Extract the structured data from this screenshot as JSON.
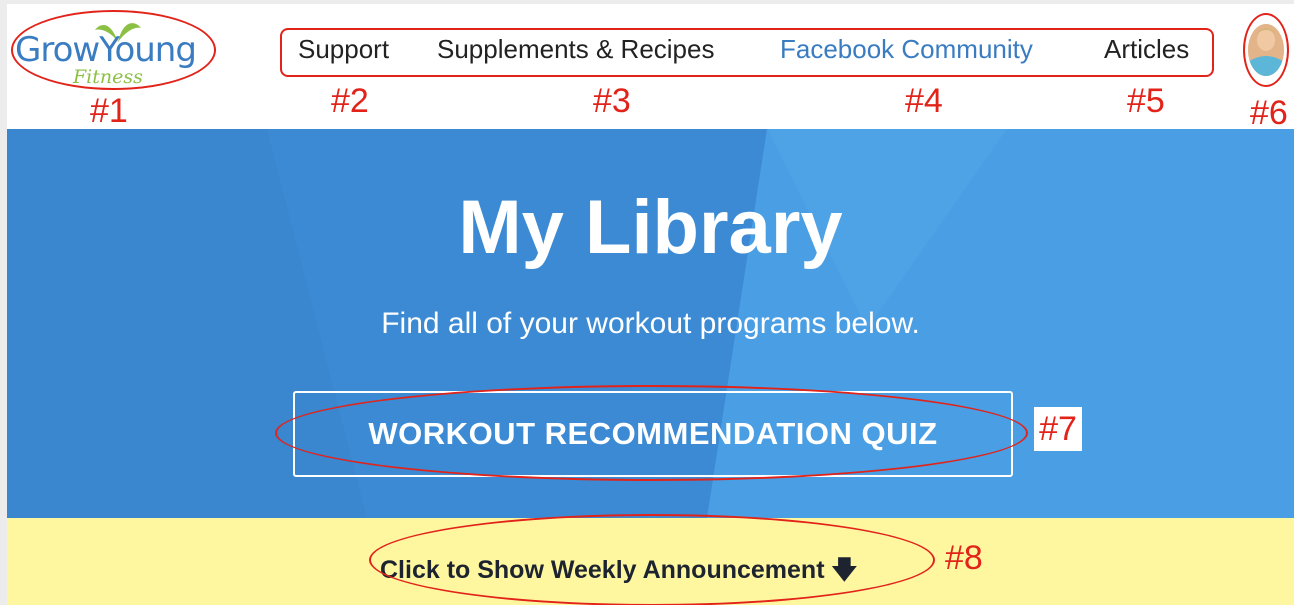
{
  "logo": {
    "wordmark": "GrowYoung",
    "script": "Fitness"
  },
  "nav": {
    "items": [
      {
        "label": "Support",
        "active": false
      },
      {
        "label": "Supplements & Recipes",
        "active": false
      },
      {
        "label": "Facebook Community",
        "active": true
      },
      {
        "label": "Articles",
        "active": false
      }
    ]
  },
  "annotations": {
    "n1": "#1",
    "n2": "#2",
    "n3": "#3",
    "n4": "#4",
    "n5": "#5",
    "n6": "#6",
    "n7": "#7",
    "n8": "#8"
  },
  "hero": {
    "title": "My Library",
    "subtitle": "Find all of your workout programs below.",
    "quiz_button": "WORKOUT RECOMMENDATION QUIZ"
  },
  "announcement": {
    "link": "Click to Show Weekly Announcement",
    "arrow": "🡇"
  },
  "colors": {
    "brand_blue": "#3a7cc1",
    "hero_blue": "#3f91d9",
    "brand_green": "#8cc045",
    "annotation_red": "#e2231a",
    "announce_bg": "#fff7a0"
  },
  "icons": {
    "avatar": "user-avatar-photo",
    "arrow": "arrow-down-icon"
  }
}
